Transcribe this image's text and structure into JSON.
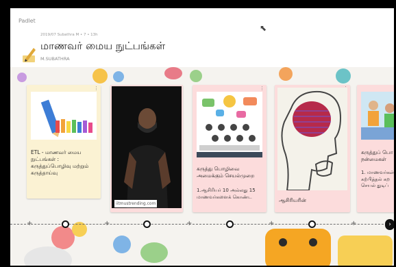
{
  "app": {
    "brand": "Padlet"
  },
  "header": {
    "meta": "2019/07 Subathra M • 7 • 13h",
    "title": "மாணவர் மைய நுட்பங்கள்",
    "author": "M.SUBATHRA"
  },
  "cards": [
    {
      "text": "ETL - மாணவர் மைய\nநுட்பங்கள் :\nகருத்துப்பொழிவு மற்றும்\nகருத்தாய்வு",
      "subtext": "",
      "link": ""
    },
    {
      "text": "",
      "subtext": "",
      "link": "iitmustrending.com"
    },
    {
      "text": "கருத்து பொழிவை\nஅமைக்கும் செயல்முறை",
      "subtext": "1.ஆசிரியர் 10 அல்லது 15\nமாணவர்களைக் கொண்ட",
      "link": ""
    },
    {
      "text": "ஆசிரியரின்",
      "subtext": "",
      "link": ""
    },
    {
      "text": "கருத்துப் பொ\nநன்மைகள்",
      "subtext": "1. மாணவர்கள்\nகற்பித்தல் கற\nசெயல் துடிப்",
      "link": ""
    }
  ],
  "icons": {
    "header": "pencil-note-icon",
    "timeline_next": "chevron-right-icon",
    "card_menu": "more-vertical-icon",
    "add": "plus-icon"
  },
  "colors": {
    "card_yellow": "#fbf2d3",
    "card_pink": "#fcdcdc",
    "timeline": "#6b6b6b"
  }
}
